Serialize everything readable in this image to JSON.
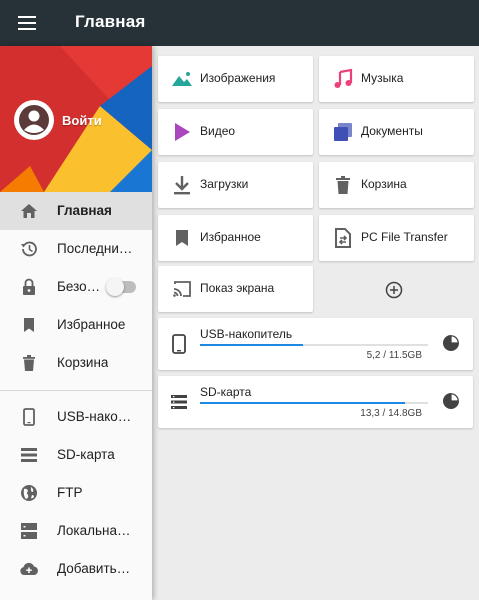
{
  "appbar": {
    "title": "Главная",
    "menu_icon": "menu-icon"
  },
  "drawer": {
    "login_label": "Войти",
    "header_colors": [
      "#d32f2f",
      "#1565c0",
      "#fbc02d",
      "#ef6c00"
    ],
    "items": [
      {
        "label": "Главная",
        "icon": "home-icon",
        "active": true
      },
      {
        "label": "Последни…",
        "icon": "history-icon"
      },
      {
        "label": "Безо…",
        "icon": "lock-icon",
        "toggle_on": false
      },
      {
        "label": "Избранное",
        "icon": "bookmark-icon"
      },
      {
        "label": "Корзина",
        "icon": "trash-icon"
      },
      {
        "label": "USB-нако…",
        "icon": "phone-icon"
      },
      {
        "label": "SD-карта",
        "icon": "storage-icon"
      },
      {
        "label": "FTP",
        "icon": "globe-icon"
      },
      {
        "label": "Локальна…",
        "icon": "server-icon"
      },
      {
        "label": "Добавить…",
        "icon": "cloud-add-icon"
      }
    ]
  },
  "tiles": [
    {
      "label": "Изображения",
      "icon": "image-icon",
      "color": "#26a69a"
    },
    {
      "label": "Музыка",
      "icon": "music-icon",
      "color": "#ec407a"
    },
    {
      "label": "Видео",
      "icon": "play-icon",
      "color": "#ab47bc"
    },
    {
      "label": "Документы",
      "icon": "documents-icon",
      "color": "#3f51b5"
    },
    {
      "label": "Загрузки",
      "icon": "download-icon",
      "color": "#616161"
    },
    {
      "label": "Корзина",
      "icon": "trash-icon",
      "color": "#616161"
    },
    {
      "label": "Избранное",
      "icon": "bookmark-icon",
      "color": "#616161"
    },
    {
      "label": "PC File Transfer",
      "icon": "pc-transfer-icon",
      "color": "#616161"
    },
    {
      "label": "Показ экрана",
      "icon": "cast-icon",
      "color": "#616161"
    }
  ],
  "add_tile_icon": "add-circle-icon",
  "storage": [
    {
      "name": "USB-накопитель",
      "usage": "5,2 / 11.5GB",
      "fraction": 0.452,
      "icon": "phone-icon"
    },
    {
      "name": "SD-карта",
      "usage": "13,3 / 14.8GB",
      "fraction": 0.899,
      "icon": "storage-icon"
    }
  ],
  "accent_color": "#1e88e5",
  "appbar_color": "#263238"
}
